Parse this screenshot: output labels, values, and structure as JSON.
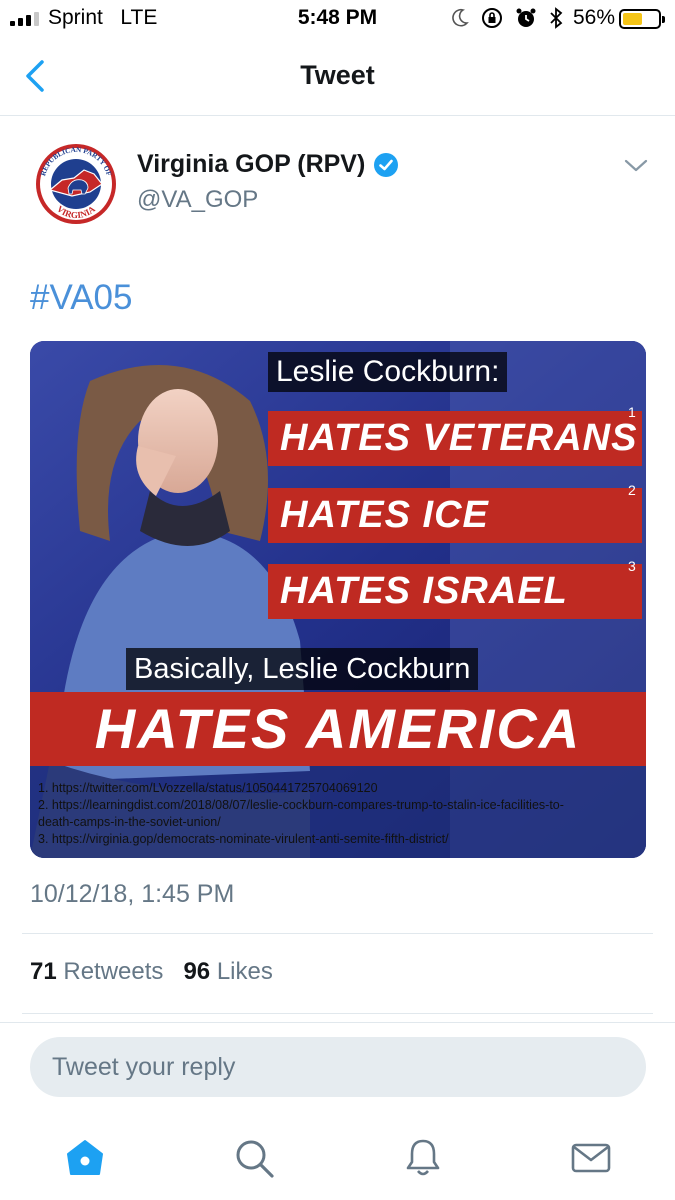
{
  "status_bar": {
    "carrier": "Sprint",
    "network": "LTE",
    "time": "5:48 PM",
    "battery_percent": "56%",
    "battery_level": 0.56,
    "icons": [
      "moon-icon",
      "rotation-lock-icon",
      "alarm-icon",
      "bluetooth-icon"
    ]
  },
  "nav": {
    "title": "Tweet",
    "back_icon": "chevron-left-icon"
  },
  "tweet": {
    "author_name": "Virginia GOP (RPV)",
    "author_handle": "@VA_GOP",
    "verified": true,
    "avatar_logo_text": [
      "REPUBLICAN PARTY OF",
      "VIRGINIA"
    ],
    "hashtag": "#VA05",
    "media": {
      "lead_text": "Leslie Cockburn:",
      "bars": [
        "HATES VETERANS",
        "HATES ICE",
        "HATES ISRAEL"
      ],
      "footnote_numbers": [
        "1",
        "2",
        "3"
      ],
      "basically_text": "Basically, Leslie Cockburn",
      "main_bar": "HATES AMERICA",
      "references": [
        "1. https://twitter.com/LVozzella/status/1050441725704069120",
        "2. https://learningdist.com/2018/08/07/leslie-cockburn-compares-trump-to-stalin-ice-facilities-to-",
        "death-camps-in-the-soviet-union/",
        "3. https://virginia.gop/democrats-nominate-virulent-anti-semite-fifth-district/"
      ]
    },
    "timestamp": "10/12/18, 1:45 PM",
    "retweets_count": "71",
    "retweets_label": "Retweets",
    "likes_count": "96",
    "likes_label": "Likes"
  },
  "reply": {
    "placeholder": "Tweet your reply"
  },
  "tabbar": {
    "items": [
      "home-icon",
      "search-icon",
      "notifications-icon",
      "messages-icon"
    ]
  },
  "colors": {
    "accent": "#1da1f2",
    "hashtag": "#4a90d9",
    "muted": "#657786",
    "banner_red": "#bf2a22",
    "battery": "#f5c518"
  }
}
